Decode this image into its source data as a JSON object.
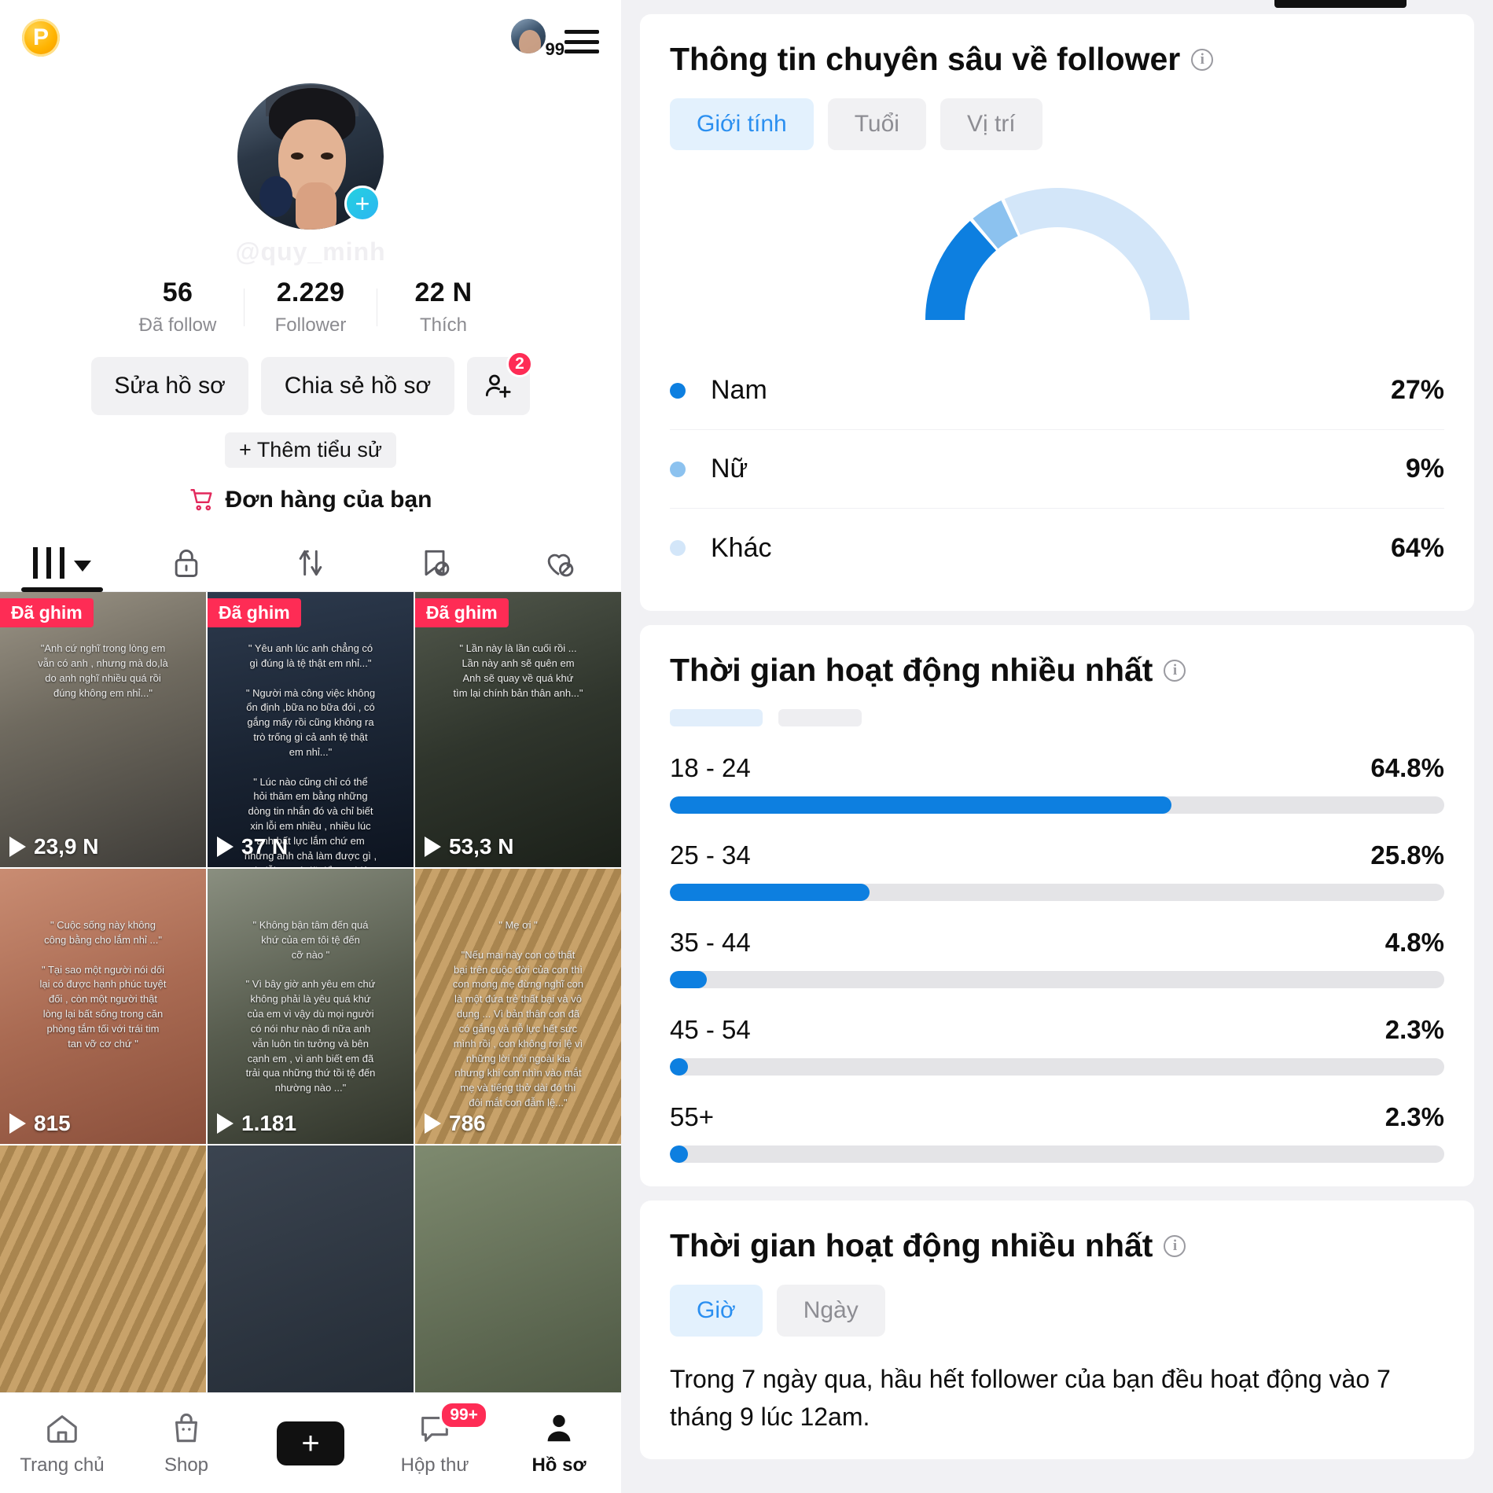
{
  "left": {
    "header": {
      "coin_label": "P",
      "avatar_badge_count": "99",
      "menu_icon": "hamburger-icon"
    },
    "profile": {
      "username_placeholder": "@quy_minh",
      "add_icon": "plus-icon"
    },
    "stats": [
      {
        "num": "56",
        "label": "Đã follow"
      },
      {
        "num": "2.229",
        "label": "Follower"
      },
      {
        "num": "22 N",
        "label": "Thích"
      }
    ],
    "actions": {
      "edit_profile": "Sửa hồ sơ",
      "share_profile": "Chia sẻ hồ sơ",
      "add_friend_badge": "2",
      "add_bio": "+ Thêm tiểu sử",
      "orders": "Đơn hàng của bạn"
    },
    "tabs": [
      {
        "icon": "grid-bars-icon",
        "active": true
      },
      {
        "icon": "lock-icon",
        "active": false
      },
      {
        "icon": "repost-icon",
        "active": false
      },
      {
        "icon": "bookmark-off-icon",
        "active": false
      },
      {
        "icon": "heart-off-icon",
        "active": false
      }
    ],
    "videos": [
      {
        "pinned": "Đã ghim",
        "views": "23,9 N",
        "caption": "\"Anh cứ nghĩ trong lòng em\nvẫn có anh , nhưng mà do,là\ndo anh nghĩ nhiều quá rồi\nđúng không em nhỉ...\""
      },
      {
        "pinned": "Đã ghim",
        "views": "37 N",
        "caption": "\" Yêu anh lúc anh chẳng có\ngì đúng là tệ thật em nhỉ...\"\n\n\" Người mà công việc không\nổn định ,bữa no bữa đói , có\ngắng mấy rồi cũng không ra\ntrò trống gì cả anh tệ thật\nem nhỉ...\"\n\n\" Lúc nào cũng chỉ có thể\nhỏi thăm em bằng những\ndòng tin nhắn đó và chỉ biết\nxin lỗi em nhiều , nhiều lúc\nanh bất lực lắm chứ em\nnhưng anh chả làm được gì ,\nxin lỗi em,vì đã để em thiệt\nthòi nhiều đến vậy...\""
      },
      {
        "pinned": "Đã ghim",
        "views": "53,3 N",
        "caption": "\" Lần này là lần cuối rồi ...\nLần này anh sẽ quên em\nAnh sẽ quay về quá khứ\ntìm lại chính bản thân anh...\""
      },
      {
        "pinned": "",
        "views": "815",
        "caption": "\" Cuộc sống này không\ncông bằng cho lắm nhỉ ...\"\n\n\" Tại sao một người nói dối\nlại có được hạnh phúc tuyệt\nđối , còn một người thật\nlòng lại bất sống trong căn\nphòng tắm tối với trái tim\ntan vỡ cơ chứ \""
      },
      {
        "pinned": "",
        "views": "1.181",
        "caption": "\" Không bận tâm đến quá\nkhứ của em tôi tệ đến\ncỡ nào \"\n\n\" Vì bây giờ anh yêu em chứ\nkhông phải là yêu quá khứ\ncủa em vì vậy dù mọi người\ncó nói như nào đi nữa anh\nvẫn luôn tin tưởng và bên\ncạnh em , vì anh biết em đã\ntrải qua những thứ tồi tệ đến\nnhường nào ...\""
      },
      {
        "pinned": "",
        "views": "786",
        "caption": "\" Mẹ ơi \"\n\n\"Nếu mai này con có thất\nbại trên cuộc đời của con thì\ncon mong mẹ đừng nghĩ con\nlà một đứa trẻ thất bại và vô\ndụng ... Vì bản thân con đã\ncó gắng và nỗ lực hết sức\nmình rồi , con không rơi lệ vì\nnhững lời nói ngoài kia\nnhưng khi con nhìn vào mắt\nmẹ và tiếng thở dài đó thì\nđôi mắt con đẫm lệ...\""
      }
    ],
    "bottom_nav": [
      {
        "icon": "home-icon",
        "label": "Trang chủ",
        "active": false
      },
      {
        "icon": "shop-bag-icon",
        "label": "Shop",
        "active": false
      },
      {
        "icon": "create-plus-icon",
        "label": "",
        "active": false
      },
      {
        "icon": "inbox-icon",
        "label": "Hộp thư",
        "badge": "99+",
        "active": false
      },
      {
        "icon": "person-icon",
        "label": "Hồ sơ",
        "active": true
      }
    ]
  },
  "right": {
    "follower_insights": {
      "title": "Thông tin chuyên sâu về follower",
      "info_icon": "info-icon",
      "segments": [
        {
          "label": "Giới tính",
          "active": true
        },
        {
          "label": "Tuổi",
          "active": false
        },
        {
          "label": "Vị trí",
          "active": false
        }
      ]
    },
    "age_section": {
      "title": "Thời gian hoạt động nhiều nhất",
      "info_icon": "info-icon"
    },
    "activity_section": {
      "title": "Thời gian hoạt động nhiều nhất",
      "info_icon": "info-icon",
      "segments": [
        {
          "label": "Giờ",
          "active": true
        },
        {
          "label": "Ngày",
          "active": false
        }
      ],
      "note": "Trong 7 ngày qua, hầu hết follower của bạn đều hoạt động vào 7 tháng 9 lúc 12am."
    }
  },
  "chart_data": [
    {
      "type": "pie",
      "title": "Thông tin chuyên sâu về follower",
      "subtitle": "Giới tính",
      "legend_position": "bottom",
      "labels": [
        "Nam",
        "Nữ",
        "Khác"
      ],
      "values": [
        27,
        9,
        64
      ],
      "value_labels": [
        "27%",
        "9%",
        "64%"
      ],
      "colors": [
        "#0d7fe0",
        "#8cc2ef",
        "#d3e6f9"
      ]
    },
    {
      "type": "bar",
      "title": "Thời gian hoạt động nhiều nhất",
      "orientation": "horizontal",
      "xlabel": "",
      "ylabel": "",
      "xlim": [
        0,
        100
      ],
      "grid": false,
      "categories": [
        "18 - 24",
        "25 - 34",
        "35 - 44",
        "45 - 54",
        "55+"
      ],
      "values": [
        64.8,
        25.8,
        4.8,
        2.3,
        2.3
      ],
      "value_labels": [
        "64.8%",
        "25.8%",
        "4.8%",
        "2.3%",
        "2.3%"
      ],
      "bar_color": "#0d7fe0",
      "track_color": "#e4e4e7"
    }
  ],
  "colors": {
    "accent_blue": "#0d7fe0",
    "accent_blue_light": "#8cc2ef",
    "accent_blue_pale": "#d3e6f9",
    "tiktok_red": "#fe2c55",
    "tiktok_cyan": "#25f4ee",
    "segment_active_bg": "#e3f1fd",
    "segment_active_text": "#2b8ff0"
  }
}
